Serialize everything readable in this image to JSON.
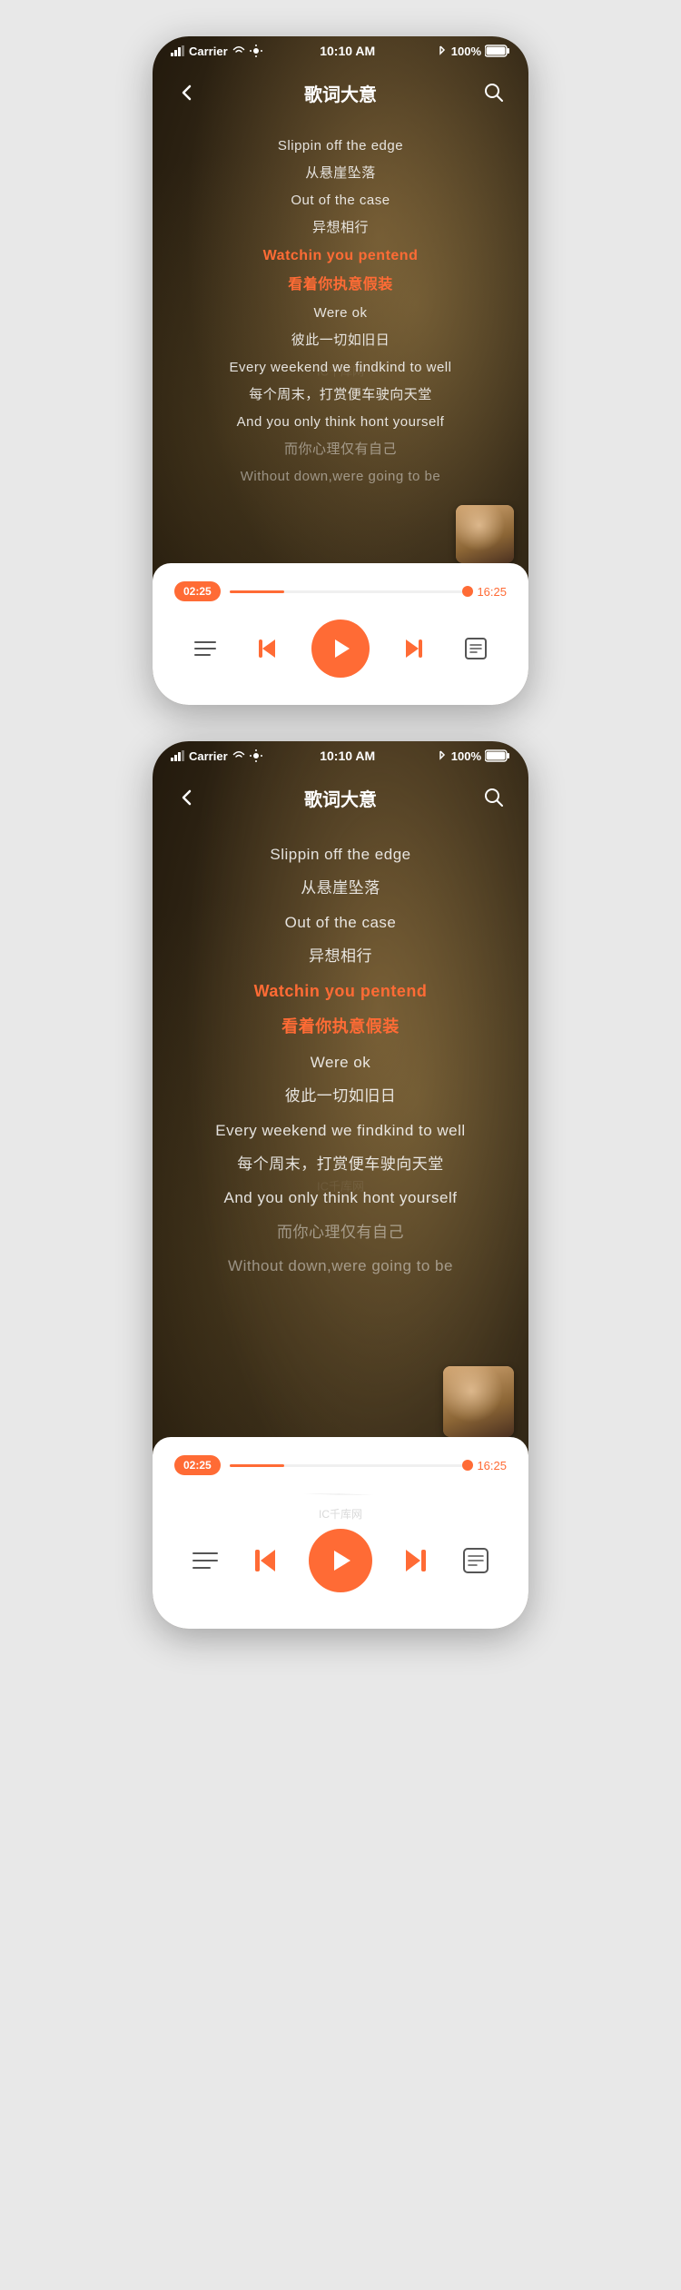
{
  "frames": [
    {
      "id": "frame1",
      "statusBar": {
        "carrier": "Carrier",
        "time": "10:10 AM",
        "battery": "100%"
      },
      "header": {
        "title": "歌词大意",
        "backLabel": "‹",
        "searchLabel": "🔍"
      },
      "lyrics": [
        {
          "text": "Slippin off the edge",
          "style": "normal"
        },
        {
          "text": "从悬崖坠落",
          "style": "normal"
        },
        {
          "text": "Out of the case",
          "style": "normal"
        },
        {
          "text": "异想相行",
          "style": "normal"
        },
        {
          "text": "Watchin you pentend",
          "style": "active"
        },
        {
          "text": "看着你执意假装",
          "style": "active"
        },
        {
          "text": "Were ok",
          "style": "normal"
        },
        {
          "text": "彼此一切如旧日",
          "style": "normal"
        },
        {
          "text": "Every weekend we findkind to well",
          "style": "normal"
        },
        {
          "text": "每个周末，打赏便车驶向天堂",
          "style": "normal"
        },
        {
          "text": "And you only think hont yourself",
          "style": "normal"
        },
        {
          "text": "而你心理仅有自己",
          "style": "dim"
        },
        {
          "text": "Without down,were going to be",
          "style": "dim"
        }
      ],
      "player": {
        "currentTime": "02:25",
        "totalTime": "16:25",
        "progressPercent": 23
      }
    },
    {
      "id": "frame2",
      "statusBar": {
        "carrier": "Carrier",
        "time": "10:10 AM",
        "battery": "100%"
      },
      "header": {
        "title": "歌词大意",
        "backLabel": "‹",
        "searchLabel": "🔍"
      },
      "lyrics": [
        {
          "text": "Slippin off the edge",
          "style": "normal"
        },
        {
          "text": "从悬崖坠落",
          "style": "normal"
        },
        {
          "text": "Out of the case",
          "style": "normal"
        },
        {
          "text": "异想相行",
          "style": "normal"
        },
        {
          "text": "Watchin you pentend",
          "style": "active"
        },
        {
          "text": "看着你执意假装",
          "style": "active"
        },
        {
          "text": "Were ok",
          "style": "normal"
        },
        {
          "text": "彼此一切如旧日",
          "style": "normal"
        },
        {
          "text": "Every weekend we findkind to well",
          "style": "normal"
        },
        {
          "text": "每个周末，打赏便车驶向天堂",
          "style": "normal"
        },
        {
          "text": "And you only think hont yourself",
          "style": "normal"
        },
        {
          "text": "而你心理仅有自己",
          "style": "dim"
        },
        {
          "text": "Without down,were going to be",
          "style": "dim"
        }
      ],
      "player": {
        "currentTime": "02:25",
        "totalTime": "16:25",
        "progressPercent": 23
      }
    }
  ],
  "controls": {
    "playlistLabel": "≡",
    "prevLabel": "⏮",
    "playLabel": "▶",
    "nextLabel": "⏭",
    "lyricsLabel": "📄"
  },
  "watermark": "IC千库网",
  "colors": {
    "accent": "#ff6b35",
    "activeText": "#ff6b35",
    "normalText": "rgba(255,255,255,0.85)",
    "dimText": "rgba(255,255,255,0.45)"
  }
}
